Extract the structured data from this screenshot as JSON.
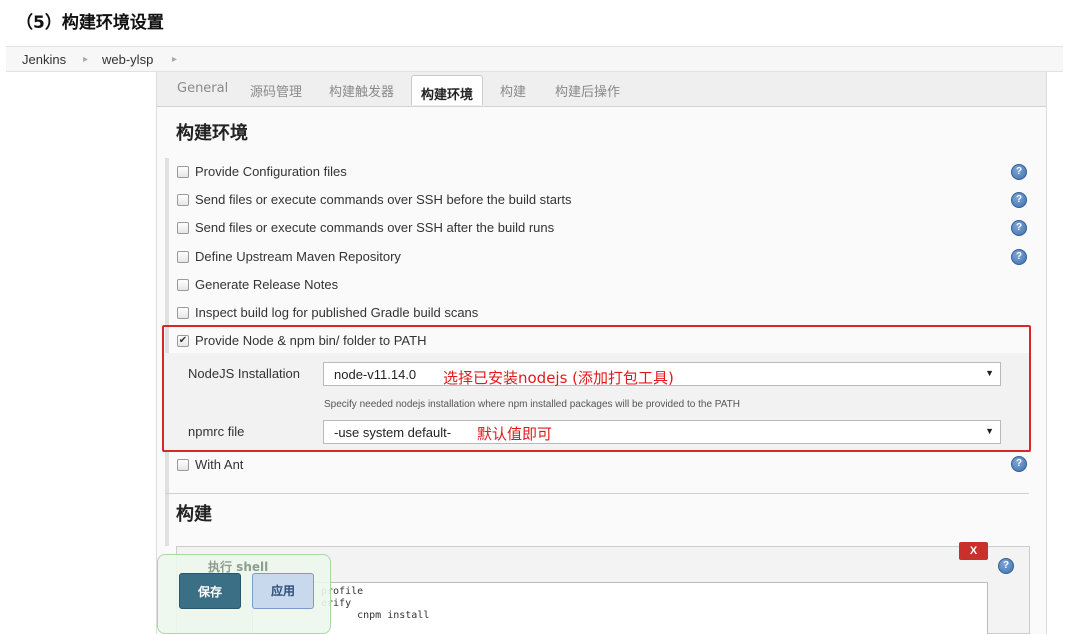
{
  "doc_title": "（5）构建环境设置",
  "breadcrumb": [
    "Jenkins",
    "web-ylsp"
  ],
  "breadcrumb_separator": "▸",
  "tabs": [
    "General",
    "源码管理",
    "构建触发器",
    "构建环境",
    "构建",
    "构建后操作"
  ],
  "active_tab": "构建环境",
  "section_env_title": "构建环境",
  "options": [
    {
      "label": "Provide Configuration files",
      "checked": false,
      "help": true
    },
    {
      "label": "Send files or execute commands over SSH before the build starts",
      "checked": false,
      "help": true
    },
    {
      "label": "Send files or execute commands over SSH after the build runs",
      "checked": false,
      "help": true
    },
    {
      "label": "Define Upstream Maven Repository",
      "checked": false,
      "help": true
    },
    {
      "label": "Generate Release Notes",
      "checked": false,
      "help": false
    },
    {
      "label": "Inspect build log for published Gradle build scans",
      "checked": false,
      "help": false
    },
    {
      "label": "Provide Node & npm bin/ folder to PATH",
      "checked": true,
      "help": false
    }
  ],
  "node": {
    "installation_label": "NodeJS Installation",
    "installation_value": "node-v11.14.0",
    "installation_annotation": "选择已安装nodejs (添加打包工具)",
    "installation_hint": "Specify needed nodejs installation where npm installed packages will be provided to the PATH",
    "npmrc_label": "npmrc file",
    "npmrc_value": "-use system default-",
    "npmrc_annotation": "默认值即可"
  },
  "with_ant": {
    "label": "With Ant",
    "checked": false
  },
  "section_build_title": "构建",
  "build_step": {
    "title": "执行 shell",
    "delete_label": "X",
    "script_fragment": "profile\nerify\n      cnpm install"
  },
  "buttons": {
    "save": "保存",
    "apply": "应用"
  },
  "help_glyph": "?",
  "check_glyph": "✔",
  "select_arrow": "▼",
  "colors": {
    "annotation": "#e0191b",
    "save": "#3a6f86",
    "apply": "#c8d9ee",
    "delete": "#c9302c"
  }
}
